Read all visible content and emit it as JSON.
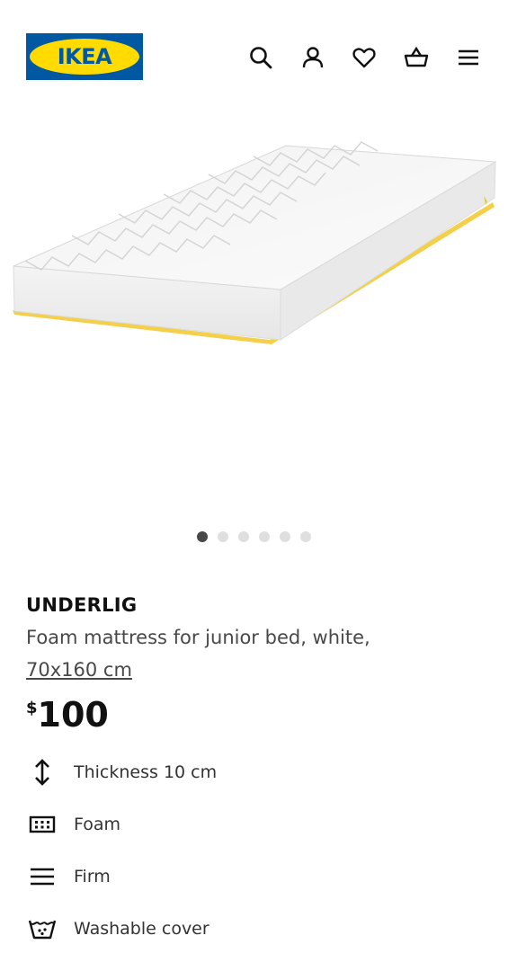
{
  "header": {
    "logo_text": "IKEA",
    "icons": [
      "search-icon",
      "user-icon",
      "heart-icon",
      "basket-icon",
      "menu-icon"
    ]
  },
  "carousel": {
    "total": 6,
    "active": 1
  },
  "product": {
    "name": "UNDERLIG",
    "description": "Foam mattress for junior bed, white,",
    "size": "70x160 cm",
    "currency": "$",
    "price": "100"
  },
  "features": [
    {
      "icon": "arrow-vertical-icon",
      "label": "Thickness 10 cm"
    },
    {
      "icon": "foam-material-icon",
      "label": "Foam"
    },
    {
      "icon": "firmness-icon",
      "label": "Firm"
    },
    {
      "icon": "washable-icon",
      "label": "Washable cover"
    }
  ],
  "colors": {
    "brand_blue": "#0058a3",
    "brand_yellow": "#ffdb00",
    "text": "#111111",
    "muted": "#484848"
  }
}
